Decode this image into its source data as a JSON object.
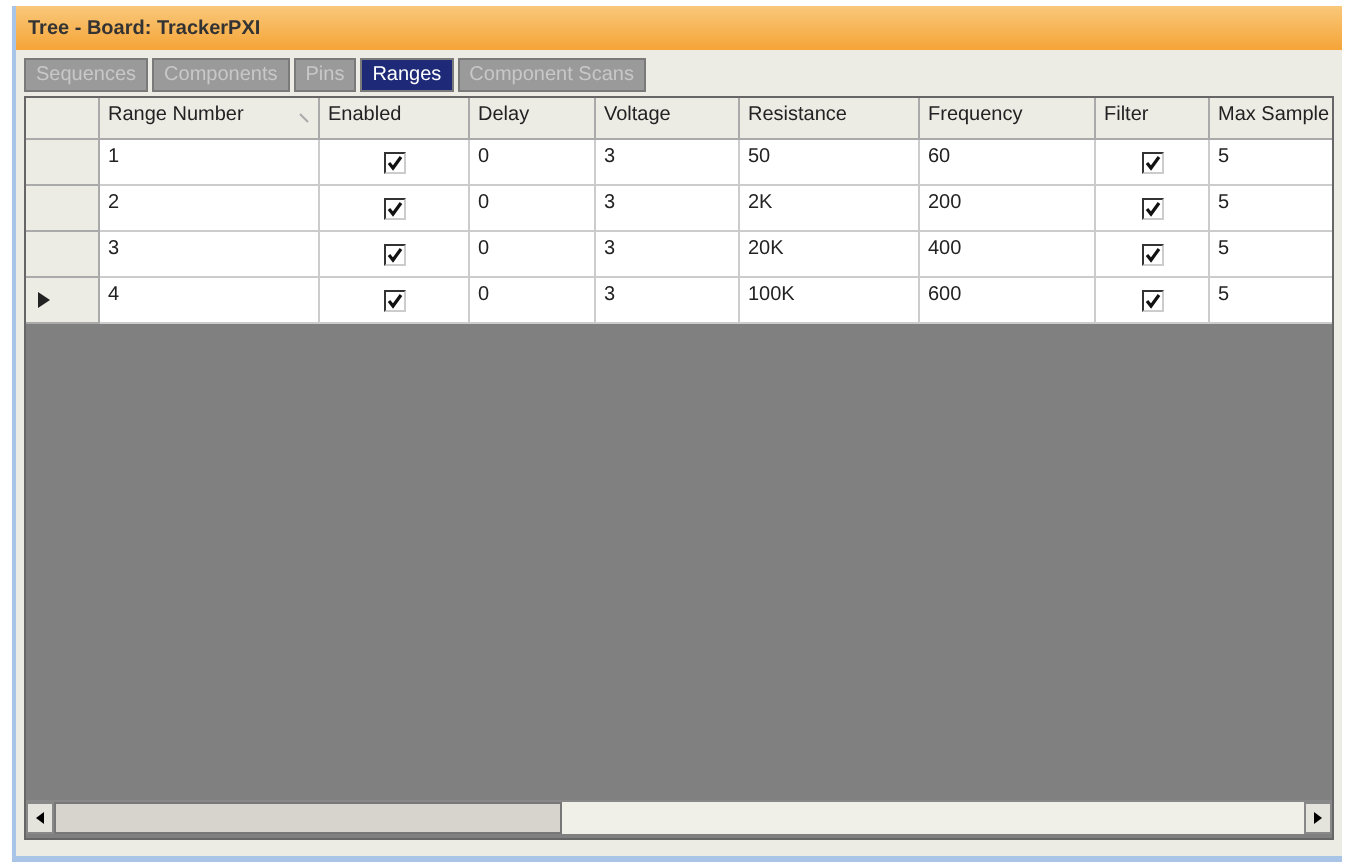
{
  "window": {
    "title": "Tree - Board: TrackerPXI"
  },
  "tabs": [
    {
      "label": "Sequences",
      "selected": false
    },
    {
      "label": "Components",
      "selected": false
    },
    {
      "label": "Pins",
      "selected": false
    },
    {
      "label": "Ranges",
      "selected": true
    },
    {
      "label": "Component Scans",
      "selected": false
    }
  ],
  "table": {
    "columns": [
      {
        "label": "Range Number",
        "kind": "text",
        "sorted": true
      },
      {
        "label": "Enabled",
        "kind": "check"
      },
      {
        "label": "Delay",
        "kind": "text"
      },
      {
        "label": "Voltage",
        "kind": "text"
      },
      {
        "label": "Resistance",
        "kind": "text"
      },
      {
        "label": "Frequency",
        "kind": "text"
      },
      {
        "label": "Filter",
        "kind": "check"
      },
      {
        "label": "Max Sample",
        "kind": "text"
      }
    ],
    "rows": [
      {
        "current": false,
        "cells": [
          "1",
          true,
          "0",
          "3",
          "50",
          "60",
          true,
          "5"
        ]
      },
      {
        "current": false,
        "cells": [
          "2",
          true,
          "0",
          "3",
          "2K",
          "200",
          true,
          "5"
        ]
      },
      {
        "current": false,
        "cells": [
          "3",
          true,
          "0",
          "3",
          "20K",
          "400",
          true,
          "5"
        ]
      },
      {
        "current": true,
        "cells": [
          "4",
          true,
          "0",
          "3",
          "100K",
          "600",
          true,
          "5"
        ]
      }
    ]
  }
}
